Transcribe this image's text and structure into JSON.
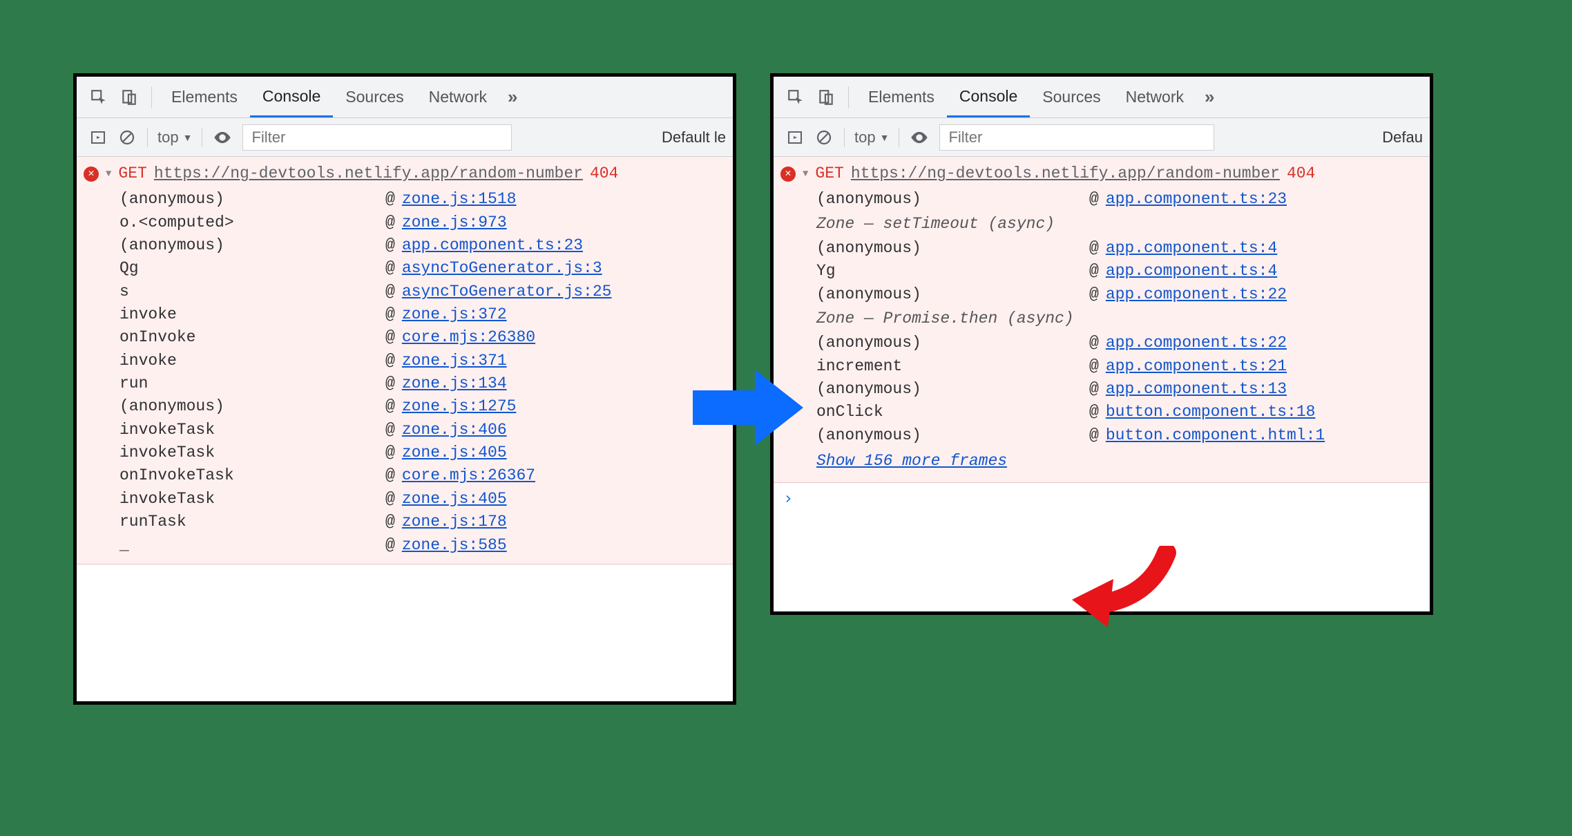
{
  "tabs": {
    "elements": "Elements",
    "console": "Console",
    "sources": "Sources",
    "network": "Network"
  },
  "toolbar": {
    "context": "top",
    "filter_placeholder": "Filter",
    "levels_left": "Default le",
    "levels_right": "Defau"
  },
  "error": {
    "method": "GET",
    "url": "https://ng-devtools.netlify.app/random-number",
    "status": "404"
  },
  "left_stack": [
    {
      "fn": "(anonymous)",
      "src": "zone.js:1518"
    },
    {
      "fn": "o.<computed>",
      "src": "zone.js:973"
    },
    {
      "fn": "(anonymous)",
      "src": "app.component.ts:23"
    },
    {
      "fn": "Qg",
      "src": "asyncToGenerator.js:3"
    },
    {
      "fn": "s",
      "src": "asyncToGenerator.js:25"
    },
    {
      "fn": "invoke",
      "src": "zone.js:372"
    },
    {
      "fn": "onInvoke",
      "src": "core.mjs:26380"
    },
    {
      "fn": "invoke",
      "src": "zone.js:371"
    },
    {
      "fn": "run",
      "src": "zone.js:134"
    },
    {
      "fn": "(anonymous)",
      "src": "zone.js:1275"
    },
    {
      "fn": "invokeTask",
      "src": "zone.js:406"
    },
    {
      "fn": "invokeTask",
      "src": "zone.js:405"
    },
    {
      "fn": "onInvokeTask",
      "src": "core.mjs:26367"
    },
    {
      "fn": "invokeTask",
      "src": "zone.js:405"
    },
    {
      "fn": "runTask",
      "src": "zone.js:178"
    },
    {
      "fn": "_",
      "src": "zone.js:585"
    }
  ],
  "right_stack": [
    {
      "type": "frame",
      "fn": "(anonymous)",
      "src": "app.component.ts:23"
    },
    {
      "type": "zone",
      "label": "Zone — setTimeout (async)"
    },
    {
      "type": "frame",
      "fn": "(anonymous)",
      "src": "app.component.ts:4"
    },
    {
      "type": "frame",
      "fn": "Yg",
      "src": "app.component.ts:4"
    },
    {
      "type": "frame",
      "fn": "(anonymous)",
      "src": "app.component.ts:22"
    },
    {
      "type": "zone",
      "label": "Zone — Promise.then (async)"
    },
    {
      "type": "frame",
      "fn": "(anonymous)",
      "src": "app.component.ts:22"
    },
    {
      "type": "frame",
      "fn": "increment",
      "src": "app.component.ts:21"
    },
    {
      "type": "frame",
      "fn": "(anonymous)",
      "src": "app.component.ts:13"
    },
    {
      "type": "frame",
      "fn": "onClick",
      "src": "button.component.ts:18"
    },
    {
      "type": "frame",
      "fn": "(anonymous)",
      "src": "button.component.html:1"
    }
  ],
  "show_more": "Show 156 more frames",
  "prompt": "›"
}
